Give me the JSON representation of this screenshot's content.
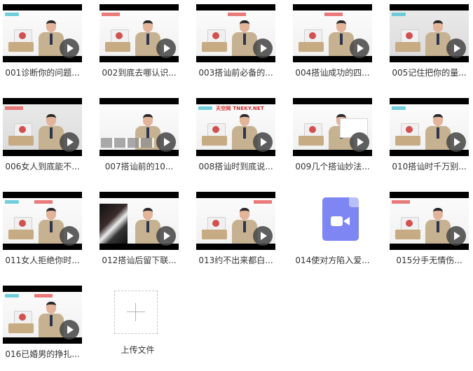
{
  "files": [
    {
      "caption": "001诊断你的问题...",
      "type": "video",
      "play_icon": "play-icon"
    },
    {
      "caption": "002到底去哪认识...",
      "type": "video",
      "play_icon": "play-icon"
    },
    {
      "caption": "003搭讪前必备的...",
      "type": "video",
      "play_icon": "play-icon"
    },
    {
      "caption": "004搭讪成功的四...",
      "type": "video",
      "play_icon": "play-icon"
    },
    {
      "caption": "005记住把你的量...",
      "type": "video",
      "play_icon": "play-icon"
    },
    {
      "caption": "006女人到底能不...",
      "type": "video",
      "play_icon": "play-icon"
    },
    {
      "caption": "007搭讪前的10...",
      "type": "video",
      "play_icon": "play-icon"
    },
    {
      "caption": "008搭讪时到底说...",
      "type": "video",
      "play_icon": "play-icon",
      "watermark": "天空网 TNEKY.NET"
    },
    {
      "caption": "009几个搭讪妙法...",
      "type": "video",
      "play_icon": "play-icon"
    },
    {
      "caption": "010搭讪时千万别...",
      "type": "video",
      "play_icon": "play-icon"
    },
    {
      "caption": "011女人拒绝你时...",
      "type": "video",
      "play_icon": "play-icon"
    },
    {
      "caption": "012搭讪后留下联...",
      "type": "video",
      "play_icon": "play-icon"
    },
    {
      "caption": "013约不出来都白...",
      "type": "video",
      "play_icon": "play-icon"
    },
    {
      "caption": "014使对方陷入爱...",
      "type": "video-file",
      "file_icon": "video-file-icon"
    },
    {
      "caption": "015分手无情伤...",
      "type": "video",
      "play_icon": "play-icon"
    },
    {
      "caption": "016已婚男的挣扎...",
      "type": "video",
      "play_icon": "play-icon"
    }
  ],
  "upload": {
    "label": "上传文件",
    "icon": "plus-icon"
  },
  "colors": {
    "caption_text": "#333333",
    "play_overlay": "#464646",
    "file_icon": "#7d86f3",
    "upload_border": "#c7c7c7"
  }
}
